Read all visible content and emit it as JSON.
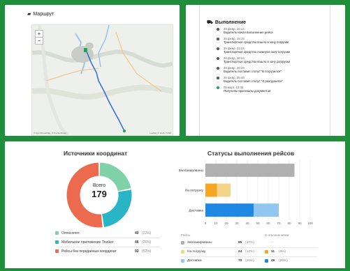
{
  "route": {
    "title": "Маршрут",
    "zoom_in": "+",
    "zoom_out": "−",
    "credit_left": "© OpenStreetMap, © TruckerRoute",
    "credit_right": "Leaflet | © 2GIS / OSM"
  },
  "execution": {
    "title": "Выполнение",
    "events": [
      {
        "date": "28 февр, 16:14",
        "text": "Водитель начал выполнение рейса"
      },
      {
        "date": "28 февр, 16:15",
        "text": "Транспортное средство вошло в зону погрузки"
      },
      {
        "date": "28 февр, 16:24",
        "text": "Транспортное средство покинуло зону погрузки"
      },
      {
        "date": "28 февр, 20:14",
        "text": "Транспортное средство вошло в зону разгрузки"
      },
      {
        "date": "28 февр, 20:20",
        "text": "Водитель поставил статус \"В погрузился\""
      },
      {
        "date": "28 февр, 20:43",
        "text": "Водитель поставил статус \"Я разгрузился\""
      },
      {
        "date": "05 март, 13:35",
        "text": "Получены оригиналы документов"
      }
    ]
  },
  "sources": {
    "title": "Источники координат",
    "center_label": "Всего",
    "total": "179",
    "items": [
      {
        "label": "Omnicomm",
        "value": "40",
        "pct": "(22%)",
        "color": "#7fd1a7",
        "fraction": 0.22
      },
      {
        "label": "Мобильное приложение Trucker",
        "value": "46",
        "pct": "(26%)",
        "color": "#2ab5c7",
        "fraction": 0.26
      },
      {
        "label": "Рейсы без переданных координат",
        "value": "93",
        "pct": "(52%)",
        "color": "#ec6a4d",
        "fraction": 0.52
      }
    ]
  },
  "statuses": {
    "title": "Статусы выполнения рейсов",
    "header_trips": "Рейсы",
    "header_deviations": "С отклонениями",
    "rows": [
      {
        "label": "Запланированы",
        "value": "85",
        "pct": "(47%)",
        "dev_value": "",
        "dev_pct": "–",
        "color": "#b0b0b0",
        "dev_color": "#b0b0b0"
      },
      {
        "label": "На погрузку",
        "value": "24",
        "pct": "(13%)",
        "dev_value": "11",
        "dev_pct": "(6%)",
        "color": "#f4d48a",
        "dev_color": "#f5a623"
      },
      {
        "label": "Доставка",
        "value": "70",
        "pct": "(39%)",
        "dev_value": "46",
        "dev_pct": "(26%)",
        "color": "#90c6f0",
        "dev_color": "#1e88e5"
      }
    ]
  },
  "chart_data": {
    "type": "bar",
    "orientation": "horizontal",
    "stacked": true,
    "categories": [
      "Запланированы",
      "На погрузку",
      "Доставка"
    ],
    "series": [
      {
        "name": "С отклонениями",
        "values": [
          0,
          11,
          46
        ]
      },
      {
        "name": "Рейсы",
        "values": [
          85,
          13,
          24
        ]
      }
    ],
    "xlim": [
      0,
      100
    ],
    "xticks": [
      "0",
      "10",
      "20",
      "30",
      "40",
      "50",
      "60",
      "70",
      "80",
      "90",
      "100"
    ],
    "grid": true
  }
}
